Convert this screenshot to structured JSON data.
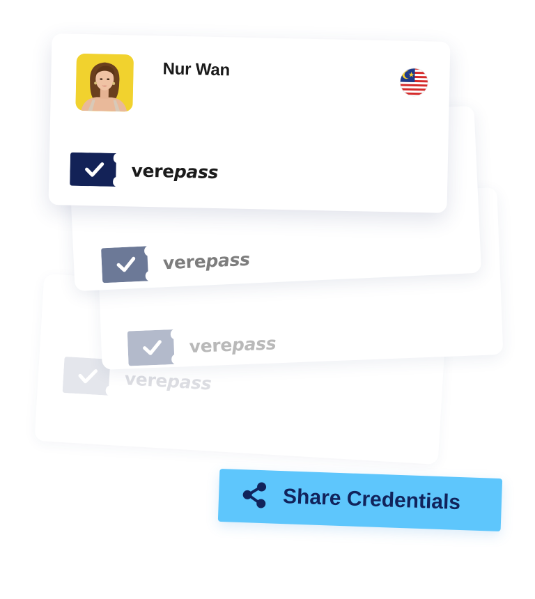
{
  "profile": {
    "name": "Nur Wan",
    "avatar_icon": "user-photo",
    "flag_icon": "malaysia-flag-icon"
  },
  "brand": {
    "prefix": "vere",
    "suffix": "pass",
    "logo_icon": "ticket-check-icon",
    "colors": {
      "primary": "#132257",
      "second": "#6c7997",
      "third": "#b3bacb",
      "fourth": "#e4e6ec"
    }
  },
  "action": {
    "share_label": "Share Credentials",
    "share_icon": "share-icon",
    "button_color": "#5ec6fc",
    "text_color": "#11235b"
  }
}
